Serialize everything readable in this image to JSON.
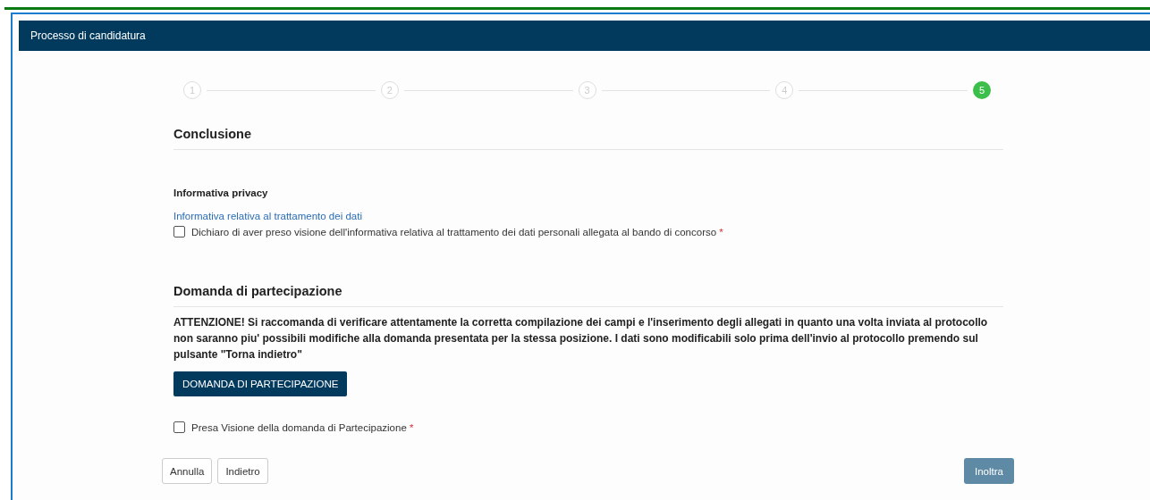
{
  "header": {
    "title": "Processo di candidatura"
  },
  "steps": [
    {
      "label": "1",
      "selected": false
    },
    {
      "label": "2",
      "selected": false
    },
    {
      "label": "3",
      "selected": false
    },
    {
      "label": "4",
      "selected": false
    },
    {
      "label": "5",
      "selected": true
    }
  ],
  "conclusion": {
    "title": "Conclusione",
    "privacy_title": "Informativa privacy",
    "privacy_link": "Informativa relativa al trattamento dei dati",
    "privacy_check": {
      "label": "Dichiaro di aver preso visione dell'informativa relativa al trattamento dei dati personali allegata al bando di concorso",
      "required_mark": "*",
      "checked": false
    }
  },
  "application": {
    "title": "Domanda di partecipazione",
    "warning": "ATTENZIONE! Si raccomanda di verificare attentamente la corretta compilazione dei campi e l'inserimento degli allegati in quanto una volta inviata al protocollo non saranno piu' possibili modifiche alla domanda presentata per la stessa posizione. I dati sono modificabili solo prima dell'invio al protocollo premendo sul pulsante \"Torna indietro\"",
    "button": "DOMANDA DI PARTECIPAZIONE",
    "view_check": {
      "label": "Presa Visione della domanda di Partecipazione",
      "required_mark": "*",
      "checked": false
    }
  },
  "footer": {
    "cancel": "Annulla",
    "back": "Indietro",
    "submit": {
      "label": "Inoltra",
      "disabled": true
    }
  }
}
